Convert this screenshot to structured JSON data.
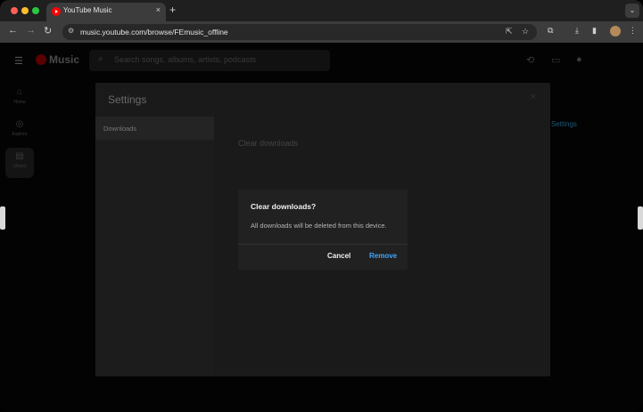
{
  "browser": {
    "tab_title": "YouTube Music",
    "tab_close": "×",
    "new_tab": "+",
    "tab_menu": "⌄",
    "url": "music.youtube.com/browse/FEmusic_offline",
    "back": "←",
    "forward": "→",
    "reload": "↻"
  },
  "app": {
    "logo_text": "Music",
    "search_placeholder": "Search songs, albums, artists, podcasts",
    "nav": [
      {
        "label": "Home",
        "icon": "home-icon"
      },
      {
        "label": "Explore",
        "icon": "compass-icon"
      },
      {
        "label": "Library",
        "icon": "library-icon"
      }
    ],
    "background_link": "Settings"
  },
  "settings": {
    "title": "Settings",
    "close": "×",
    "sidebar_item": "Downloads",
    "main_item": "Clear downloads"
  },
  "dialog": {
    "title": "Clear downloads?",
    "body": "All downloads will be deleted from this device.",
    "cancel": "Cancel",
    "remove": "Remove",
    "accent_color": "#3ea6ff"
  }
}
